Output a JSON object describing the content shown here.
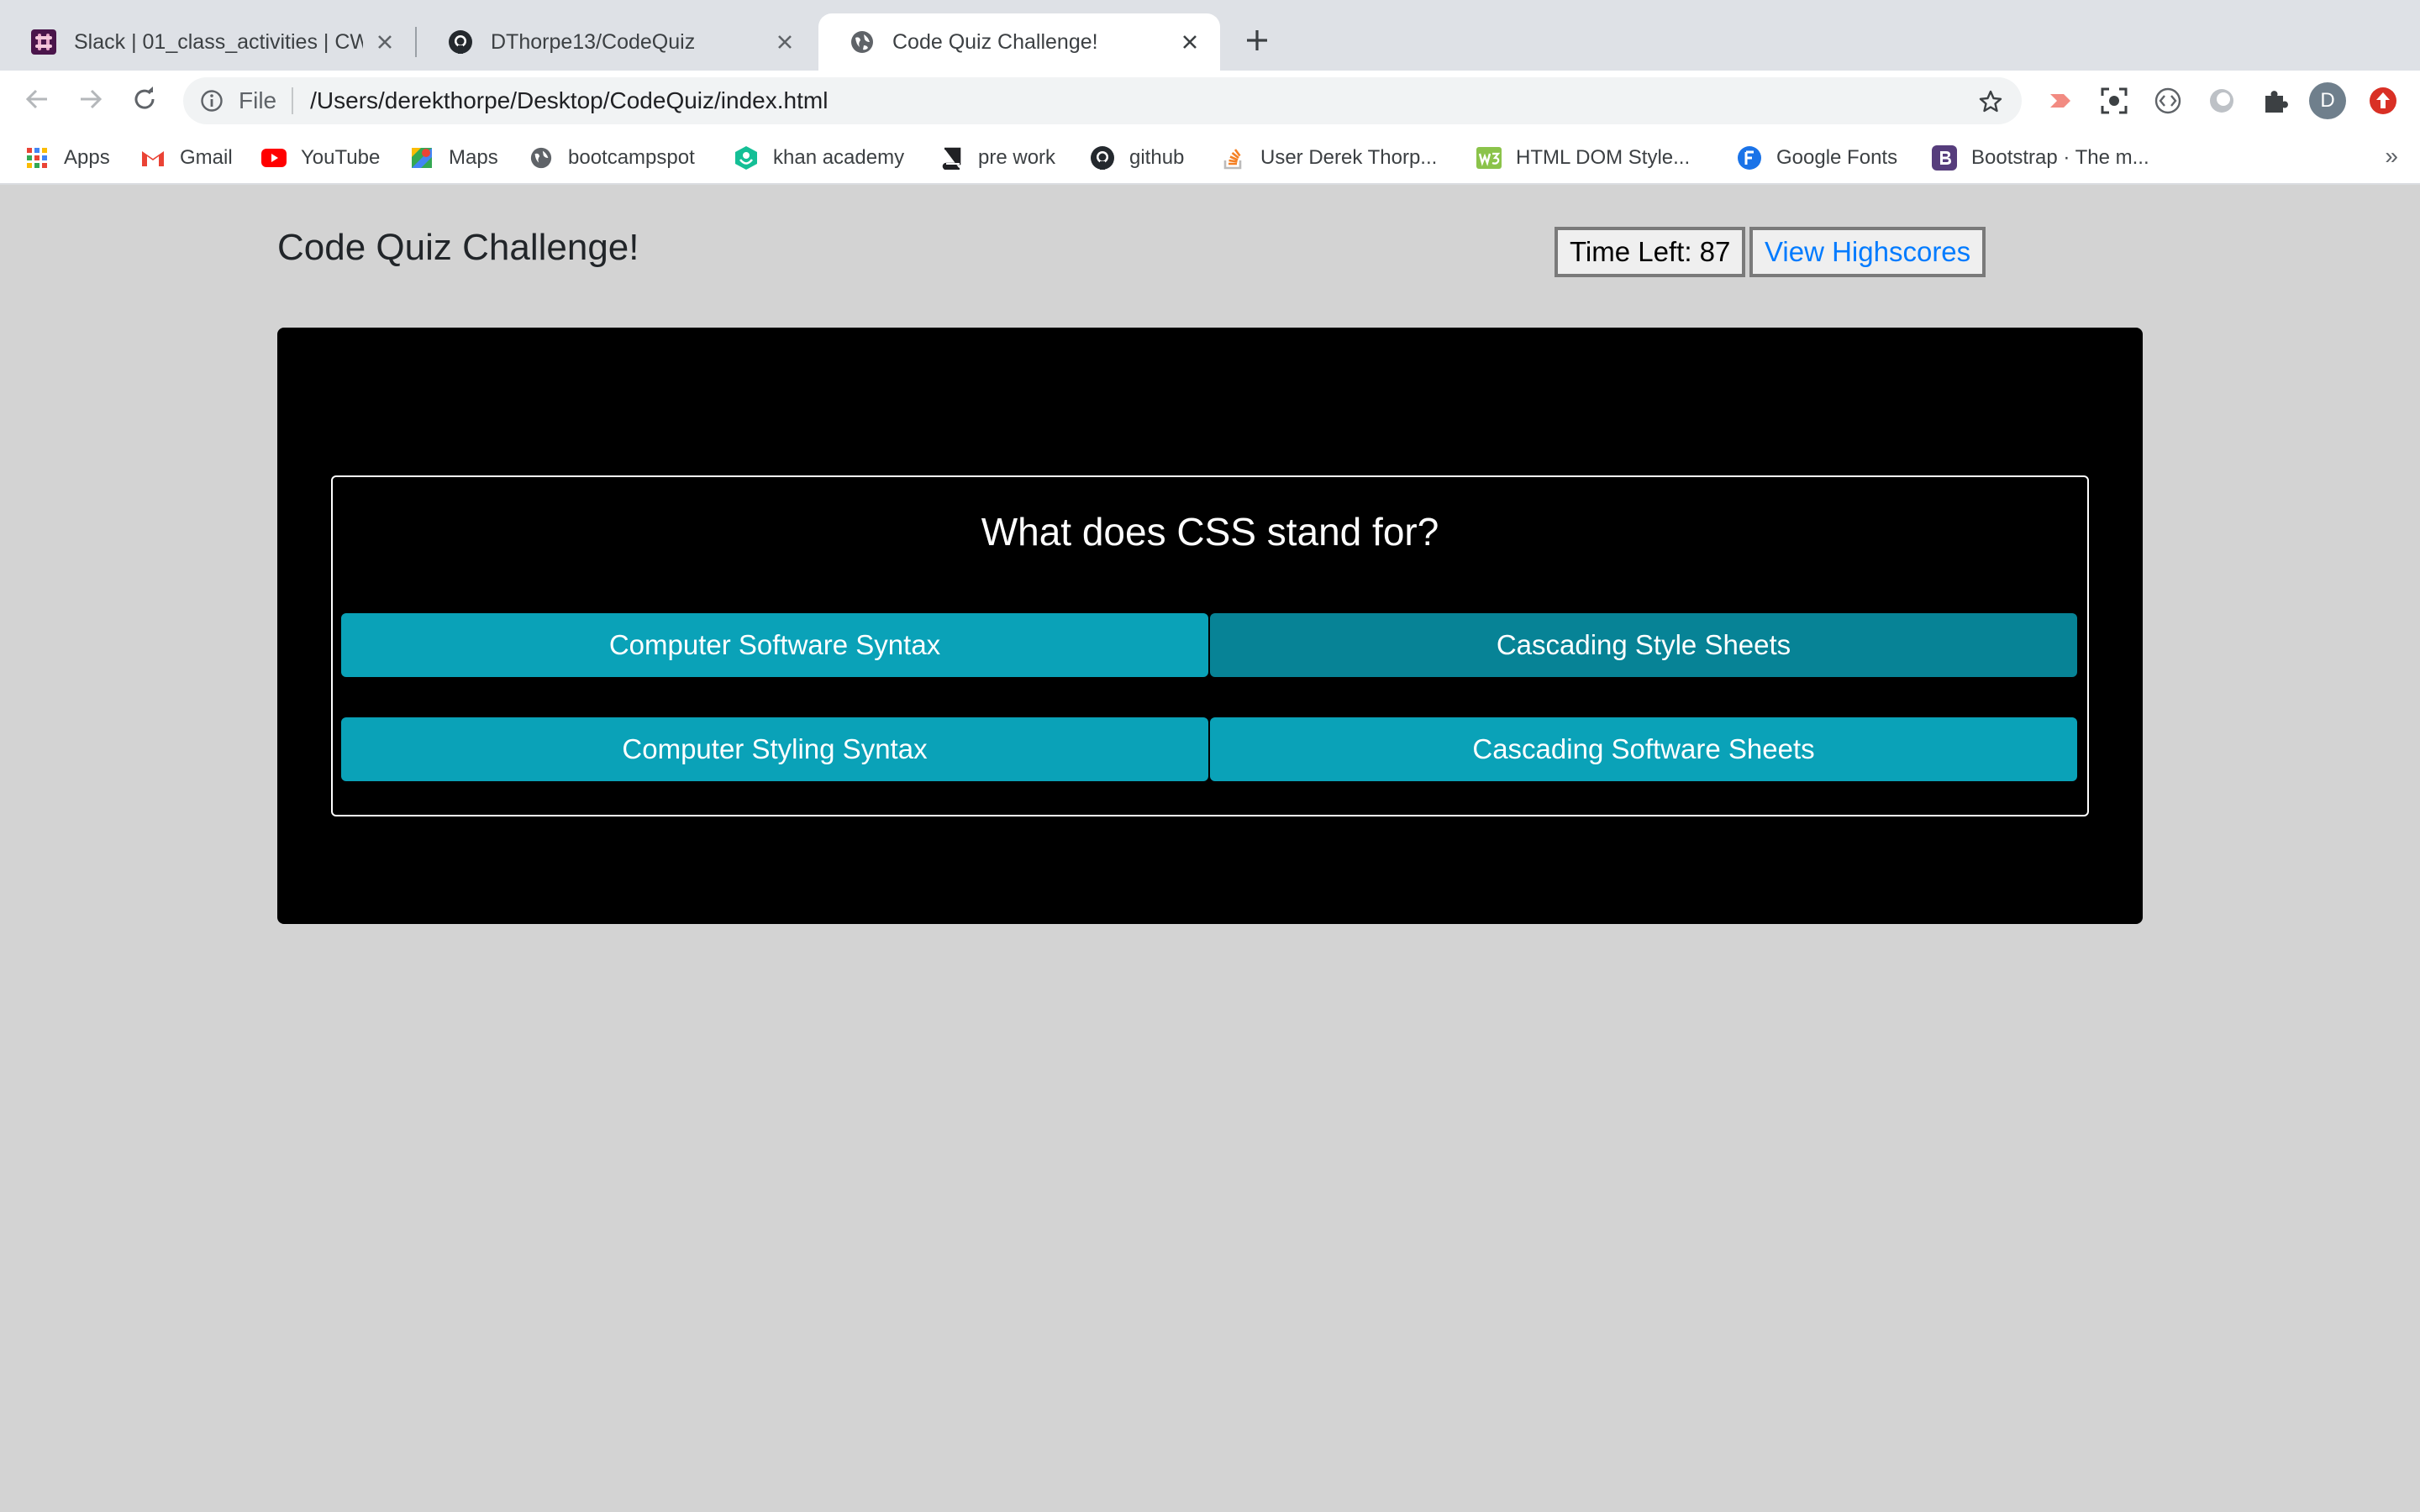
{
  "browser": {
    "tabs": [
      {
        "title": "Slack | 01_class_activities | CW",
        "icon": "slack-icon"
      },
      {
        "title": "DThorpe13/CodeQuiz",
        "icon": "github-icon"
      },
      {
        "title": "Code Quiz Challenge!",
        "icon": "globe-icon",
        "active": true
      }
    ],
    "address_bar": {
      "scheme": "File",
      "url": "/Users/derekthorpe/Desktop/CodeQuiz/index.html"
    },
    "profile_initial": "D",
    "bookmarks": [
      {
        "label": "Apps",
        "icon": "apps-grid-icon"
      },
      {
        "label": "Gmail",
        "icon": "gmail-icon"
      },
      {
        "label": "YouTube",
        "icon": "youtube-icon"
      },
      {
        "label": "Maps",
        "icon": "maps-icon"
      },
      {
        "label": "bootcampspot",
        "icon": "globe-icon"
      },
      {
        "label": "khan academy",
        "icon": "khan-academy-icon"
      },
      {
        "label": "pre work",
        "icon": "book-icon"
      },
      {
        "label": "github",
        "icon": "github-icon"
      },
      {
        "label": "User Derek Thorp...",
        "icon": "stackoverflow-icon"
      },
      {
        "label": "HTML DOM Style...",
        "icon": "w3schools-icon"
      },
      {
        "label": "Google Fonts",
        "icon": "google-fonts-icon"
      },
      {
        "label": "Bootstrap · The m...",
        "icon": "bootstrap-icon"
      }
    ],
    "bookmarks_overflow": "»"
  },
  "page": {
    "title": "Code Quiz Challenge!",
    "timer": "Time Left: 87",
    "highscores_link": "View Highscores",
    "question": "What does CSS stand for?",
    "answers": [
      "Computer Software Syntax",
      "Cascading Style Sheets",
      "Computer Styling Syntax",
      "Cascading Software Sheets"
    ]
  },
  "colors": {
    "page_background": "#d3d3d3",
    "panel_background": "#000000",
    "answer_button": "#0aa2b8",
    "answer_button_hover": "#078396",
    "link": "#007bff"
  }
}
